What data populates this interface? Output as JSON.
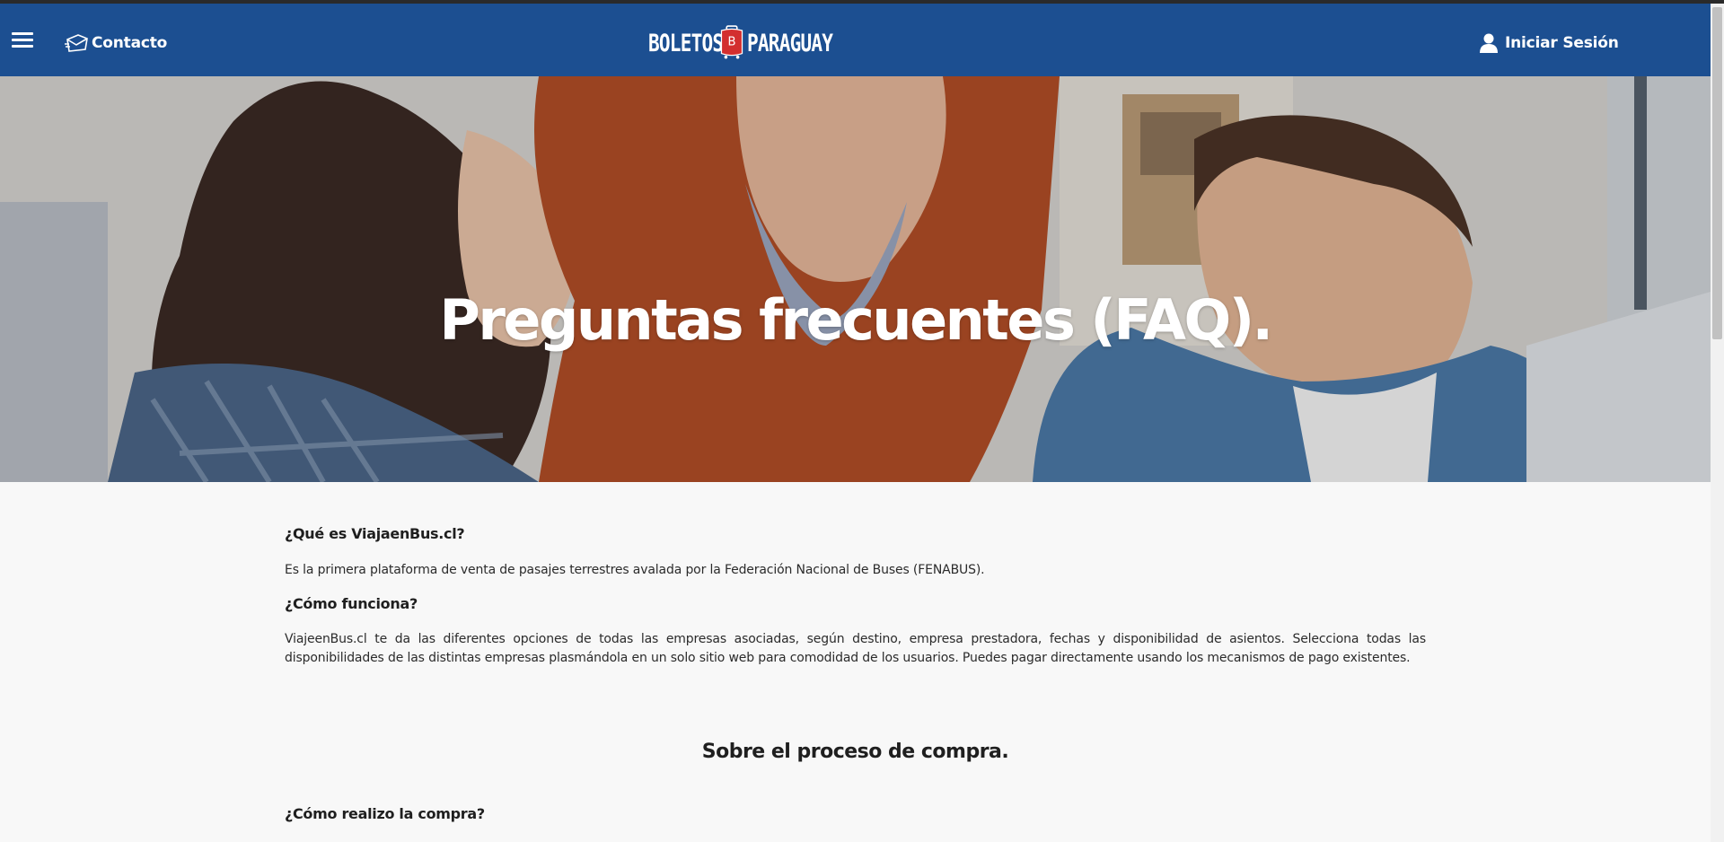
{
  "header": {
    "contact_label": "Contacto",
    "logo": {
      "left": "Boletos",
      "badge": "B",
      "right": "Paraguay"
    },
    "login_label": "Iniciar Sesión",
    "background_color": "#1c4f91"
  },
  "hero": {
    "title": "Preguntas frecuentes (FAQ)."
  },
  "faq": [
    {
      "question": "¿Qué es ViajaenBus.cl?",
      "answer": "Es la primera plataforma de venta de pasajes terrestres avalada por la Federación Nacional de Buses (FENABUS)."
    },
    {
      "question": "¿Cómo funciona?",
      "answer": "ViajeenBus.cl te da las diferentes opciones de todas las empresas asociadas, según destino, empresa prestadora, fechas y disponibilidad de asientos. Selecciona todas las disponibilidades de las distintas empresas plasmándola en un solo sitio web para comodidad de los usuarios. Puedes pagar directamente usando los mecanismos de pago existentes."
    }
  ],
  "section": {
    "title": "Sobre el proceso de compra.",
    "first_question": "¿Cómo realizo la compra?"
  }
}
